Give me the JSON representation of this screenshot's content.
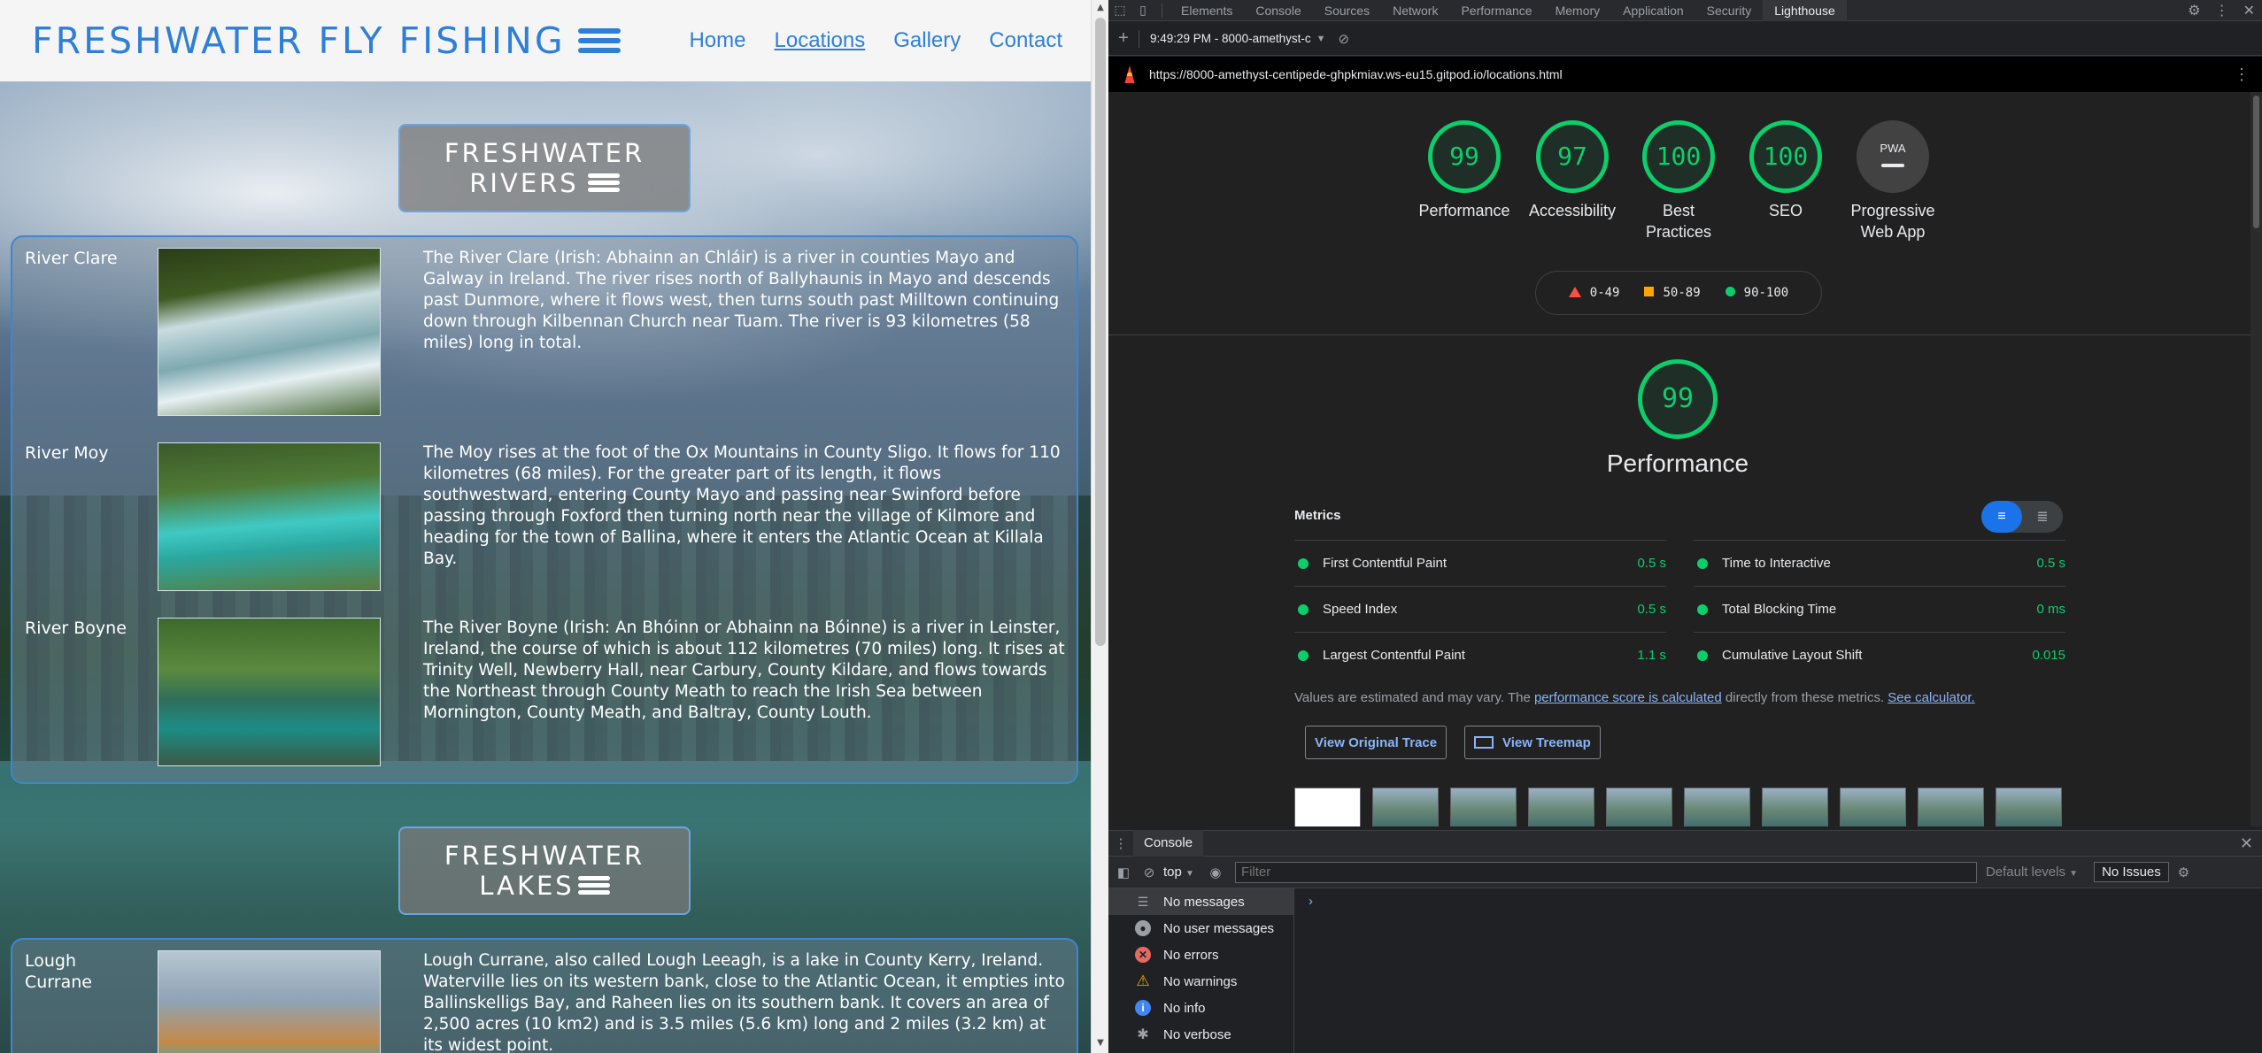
{
  "site": {
    "title": "FRESHWATER FLY FISHING",
    "nav": [
      "Home",
      "Locations",
      "Gallery",
      "Contact"
    ],
    "active_nav": "Locations"
  },
  "rivers_section": {
    "title_line1": "FRESHWATER",
    "title_line2": "RIVERS",
    "entries": [
      {
        "name": "River Clare",
        "desc": "The River Clare (Irish: Abhainn an Chláir) is a river in counties Mayo and Galway in Ireland. The river rises north of Ballyhaunis in Mayo and descends past Dunmore, where it flows west, then turns south past Milltown continuing down through Kilbennan Church near Tuam. The river is 93 kilometres (58 miles) long in total."
      },
      {
        "name": "River Moy",
        "desc": "The Moy rises at the foot of the Ox Mountains in County Sligo. It flows for 110 kilometres (68 miles). For the greater part of its length, it flows southwestward, entering County Mayo and passing near Swinford before passing through Foxford then turning north near the village of Kilmore and heading for the town of Ballina, where it enters the Atlantic Ocean at Killala Bay."
      },
      {
        "name": "River Boyne",
        "desc": "The River Boyne (Irish: An Bhóinn or Abhainn na Bóinne) is a river in Leinster, Ireland, the course of which is about 112 kilometres (70 miles) long. It rises at Trinity Well, Newberry Hall, near Carbury, County Kildare, and flows towards the Northeast through County Meath to reach the Irish Sea between Mornington, County Meath, and Baltray, County Louth."
      }
    ]
  },
  "lakes_section": {
    "title_line1": "FRESHWATER",
    "title_line2": "LAKES",
    "entries": [
      {
        "name": "Lough Currane",
        "desc": "Lough Currane, also called Lough Leeagh, is a lake in County Kerry, Ireland. Waterville lies on its western bank, close to the Atlantic Ocean, it empties into Ballinskelligs Bay, and Raheen lies on its southern bank. It covers an area of 2,500 acres (10 km2) and is 3.5 miles (5.6 km) long and 2 miles (3.2 km) at its widest point."
      }
    ]
  },
  "devtools": {
    "tabs": [
      "Elements",
      "Console",
      "Sources",
      "Network",
      "Performance",
      "Memory",
      "Application",
      "Security",
      "Lighthouse"
    ],
    "active_tab": "Lighthouse",
    "report_selector": "9:49:29 PM - 8000-amethyst-c",
    "url": "https://8000-amethyst-centipede-ghpkmiav.ws-eu15.gitpod.io/locations.html",
    "scores": [
      {
        "label": "Performance",
        "value": "99"
      },
      {
        "label": "Accessibility",
        "value": "97"
      },
      {
        "label": "Best Practices",
        "value": "100"
      },
      {
        "label": "SEO",
        "value": "100"
      }
    ],
    "pwa": {
      "label": "Progressive Web App",
      "badge": "PWA"
    },
    "legend": {
      "low": "0-49",
      "mid": "50-89",
      "high": "90-100"
    },
    "colors": {
      "pass": "#0cce6b",
      "average": "#ffa400",
      "fail": "#ff4e42",
      "link": "#8ab4f8"
    },
    "performance": {
      "score": "99",
      "title": "Performance",
      "metrics_label": "Metrics",
      "metrics": [
        {
          "name": "First Contentful Paint",
          "value": "0.5 s"
        },
        {
          "name": "Time to Interactive",
          "value": "0.5 s"
        },
        {
          "name": "Speed Index",
          "value": "0.5 s"
        },
        {
          "name": "Total Blocking Time",
          "value": "0 ms"
        },
        {
          "name": "Largest Contentful Paint",
          "value": "1.1 s"
        },
        {
          "name": "Cumulative Layout Shift",
          "value": "0.015"
        }
      ],
      "note_prefix": "Values are estimated and may vary. The ",
      "note_link1": "performance score is calculated",
      "note_middle": " directly from these metrics. ",
      "note_link2": "See calculator.",
      "btn_trace": "View Original Trace",
      "btn_treemap": "View Treemap"
    },
    "console": {
      "tab": "Console",
      "context": "top",
      "filter_placeholder": "Filter",
      "levels": "Default levels",
      "issues": "No Issues",
      "sidebar": [
        {
          "label": "No messages",
          "icon": "list-icon"
        },
        {
          "label": "No user messages",
          "icon": "user-icon"
        },
        {
          "label": "No errors",
          "icon": "error-icon"
        },
        {
          "label": "No warnings",
          "icon": "warning-icon"
        },
        {
          "label": "No info",
          "icon": "info-icon"
        },
        {
          "label": "No verbose",
          "icon": "verbose-icon"
        }
      ]
    }
  }
}
